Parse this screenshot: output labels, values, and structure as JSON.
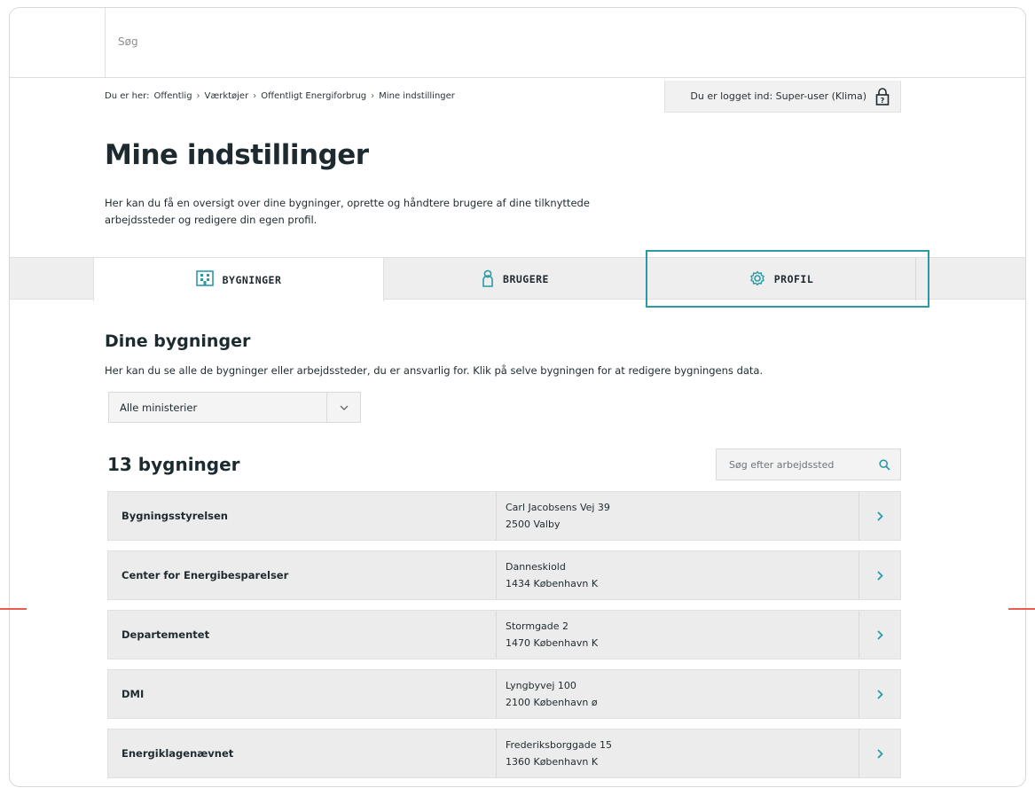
{
  "search": {
    "placeholder": "Søg"
  },
  "breadcrumb": {
    "prefix": "Du er her:",
    "items": [
      "Offentlig",
      "Værktøjer",
      "Offentligt Energiforbrug",
      "Mine indstillinger"
    ],
    "separator": "›"
  },
  "login": {
    "label": "Du er logget ind: Super-user (Klima)",
    "icon": "lock-icon"
  },
  "page": {
    "title": "Mine indstillinger",
    "intro": "Her kan du få en oversigt over dine bygninger, oprette og håndtere brugere af dine tilknyttede arbejdssteder og redigere din egen profil."
  },
  "tabs": [
    {
      "label": "BYGNINGER",
      "icon": "building-icon",
      "active": true
    },
    {
      "label": "BRUGERE",
      "icon": "user-icon",
      "active": false
    },
    {
      "label": "PROFIL",
      "icon": "gear-icon",
      "active": false
    }
  ],
  "colors": {
    "accent": "#2c9aa6",
    "text": "#1d2b31",
    "row_bg": "#ececec",
    "marker": "#e8604c"
  },
  "buildings_section": {
    "title": "Dine bygninger",
    "description": "Her kan du se alle de bygninger eller arbejdssteder, du er ansvarlig for. Klik på selve bygningen for at redigere bygningens data.",
    "filter_value": "Alle ministerier",
    "count_label": "13 bygninger",
    "search_placeholder": "Søg efter arbejdssted"
  },
  "buildings": [
    {
      "name": "Bygningsstyrelsen",
      "street": "Carl Jacobsens Vej 39",
      "city": "2500 Valby"
    },
    {
      "name": "Center for Energibesparelser",
      "street": "Danneskiold",
      "city": "1434 København K"
    },
    {
      "name": "Departementet",
      "street": "Stormgade 2",
      "city": "1470 København K"
    },
    {
      "name": "DMI",
      "street": "Lyngbyvej 100",
      "city": "2100 København ø"
    },
    {
      "name": "Energiklagenævnet",
      "street": "Frederiksborggade 15",
      "city": "1360 København K"
    }
  ]
}
